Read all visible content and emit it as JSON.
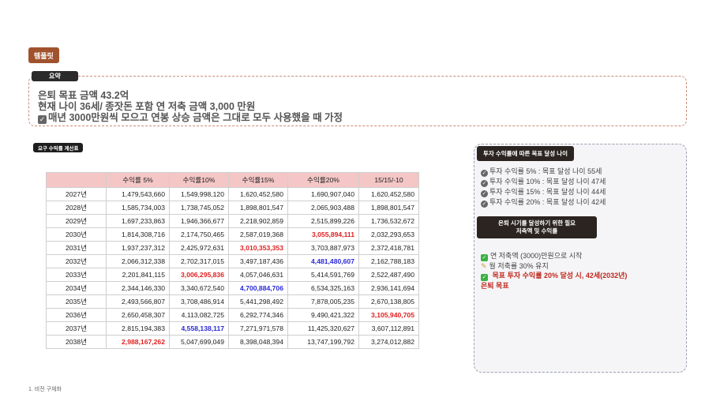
{
  "template_label": "템플릿",
  "summary": {
    "label": "요약",
    "line1": "은퇴 목표 금액 43.2억",
    "line2": "현재 나이 36세/ 종잣돈 포함 연 저축 금액 3,000 만원",
    "line3": "매년 3000만원씩 모으고 연봉 상승 금액은 그대로 모두 사용했을 때 가정"
  },
  "calc": {
    "label": "요구 수익률 계산표",
    "headers": [
      "",
      "수익률 5%",
      "수익률10%",
      "수익률15%",
      "수익률20%",
      "15/15/-10"
    ],
    "rows": [
      [
        "2027년",
        "1,479,543,660",
        "1,549,998,120",
        "1,620,452,580",
        "1,690,907,040",
        "1,620,452,580"
      ],
      [
        "2028년",
        "1,585,734,003",
        "1,738,745,052",
        "1,898,801,547",
        "2,065,903,488",
        "1,898,801,547"
      ],
      [
        "2029년",
        "1,697,233,863",
        "1,946,366,677",
        "2,218,902,859",
        "2,515,899,226",
        "1,736,532,672"
      ],
      [
        "2030년",
        "1,814,308,716",
        "2,174,750,465",
        "2,587,019,368",
        "3,055,894,111",
        "2,032,293,653"
      ],
      [
        "2031년",
        "1,937,237,312",
        "2,425,972,631",
        "3,010,353,353",
        "3,703,887,973",
        "2,372,418,781"
      ],
      [
        "2032년",
        "2,066,312,338",
        "2,702,317,015",
        "3,497,187,436",
        "4,481,480,607",
        "2,162,788,183"
      ],
      [
        "2033년",
        "2,201,841,115",
        "3,006,295,836",
        "4,057,046,631",
        "5,414,591,769",
        "2,522,487,490"
      ],
      [
        "2034년",
        "2,344,146,330",
        "3,340,672,540",
        "4,700,884,706",
        "6,534,325,163",
        "2,936,141,694"
      ],
      [
        "2035년",
        "2,493,566,807",
        "3,708,486,914",
        "5,441,298,492",
        "7,878,005,235",
        "2,670,138,805"
      ],
      [
        "2036년",
        "2,650,458,307",
        "4,113,082,725",
        "6,292,774,346",
        "9,490,421,322",
        "3,105,940,705"
      ],
      [
        "2037년",
        "2,815,194,383",
        "4,558,138,117",
        "7,271,971,578",
        "11,425,320,627",
        "3,607,112,891"
      ],
      [
        "2038년",
        "2,988,167,262",
        "5,047,699,049",
        "8,398,048,394",
        "13,747,199,792",
        "3,274,012,882"
      ]
    ],
    "highlights": [
      {
        "row": 3,
        "col": 4,
        "color": "red"
      },
      {
        "row": 4,
        "col": 3,
        "color": "red"
      },
      {
        "row": 5,
        "col": 4,
        "color": "blue"
      },
      {
        "row": 6,
        "col": 2,
        "color": "red"
      },
      {
        "row": 7,
        "col": 3,
        "color": "blue"
      },
      {
        "row": 9,
        "col": 5,
        "color": "red"
      },
      {
        "row": 10,
        "col": 2,
        "color": "blue"
      },
      {
        "row": 11,
        "col": 1,
        "color": "red"
      }
    ],
    "colors": {
      "red": "#e02020",
      "blue": "#2a2ad8",
      "header_bg": "#f4c6c6"
    }
  },
  "goal_age": {
    "label": "투자 수익률에 따른 목표 달성 나이",
    "items": [
      "투자 수익률 5% : 목표 달성 나이 55세",
      "투자 수익률 10% : 목표 달성 나이 47세",
      "투자 수익률 15% : 목표 달성 나이 44세",
      "투자 수익률 20% : 목표 달성 나이 42세"
    ]
  },
  "invest": {
    "label_line1": "은퇴 시기를 달성하기 위한 필요",
    "label_line2": "저축액 및 수익률",
    "item1": "연 저축액 (3000)만원으로 시작",
    "item2": "월 저축률 30% 유지",
    "item3": "목표 투자 수익률 20% 달성 시, 42세(2032년)",
    "item3_cont": "은퇴 목표"
  },
  "footer": "1. 비전 구체화"
}
